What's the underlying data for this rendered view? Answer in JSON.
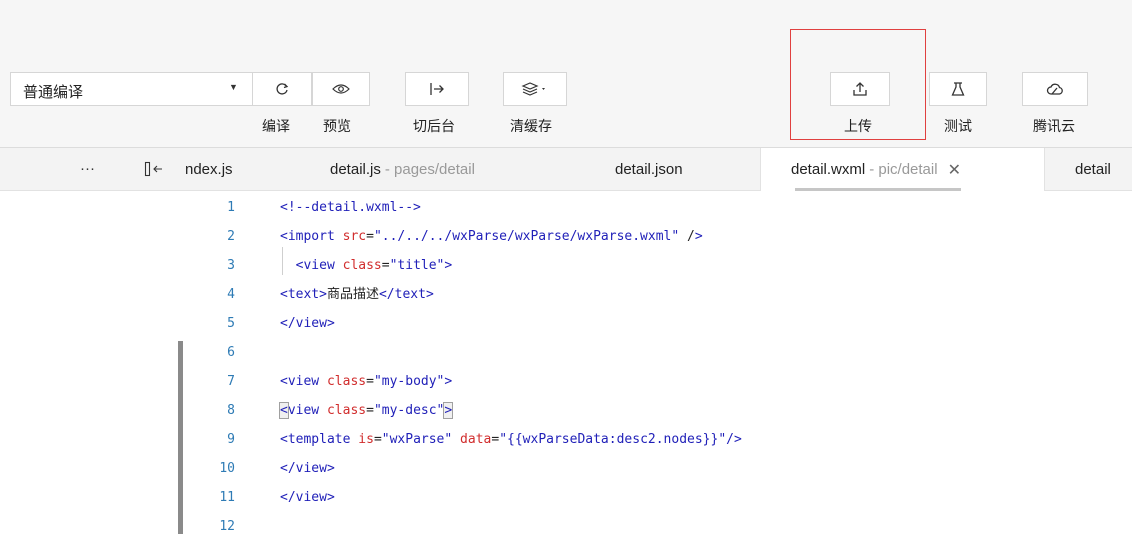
{
  "toolbar": {
    "compile_mode": "普通编译",
    "buttons": {
      "compile": "编译",
      "preview": "预览",
      "backend": "切后台",
      "clear_cache": "清缓存",
      "upload": "上传",
      "test": "测试",
      "tencent_cloud": "腾讯云"
    }
  },
  "tabs": {
    "more": "···",
    "items": [
      {
        "name": "ndex.js",
        "path": ""
      },
      {
        "name": "detail.js",
        "path": "- pages/detail"
      },
      {
        "name": "detail.json",
        "path": ""
      },
      {
        "name": "detail.wxml",
        "path": "- pic/detail"
      },
      {
        "name": "detail",
        "path": ""
      }
    ],
    "close_glyph": "✕"
  },
  "editor": {
    "line_numbers": [
      "1",
      "2",
      "3",
      "4",
      "5",
      "6",
      "7",
      "8",
      "9",
      "10",
      "11",
      "12"
    ],
    "lines": [
      "<!--detail.wxml-->",
      "<import src=\"../../../wxParse/wxParse/wxParse.wxml\" />",
      "  <view class=\"title\">",
      "<text>商品描述</text>",
      "</view>",
      "",
      "<view class=\"my-body\">",
      "<view class=\"my-desc\">",
      "<template is=\"wxParse\" data=\"{{wxParseData:desc2.nodes}}\"/>",
      "</view>",
      "</view>",
      ""
    ]
  },
  "icons": {
    "compile": "refresh-icon",
    "preview": "eye-icon",
    "backend": "switch-background-icon",
    "clear_cache": "layers-icon",
    "upload": "upload-icon",
    "test": "flask-icon",
    "tencent_cloud": "cloud-icon"
  },
  "colors": {
    "highlight_border": "#e0403f",
    "line_number": "#2e7bb5",
    "tag": "#1f1fb8",
    "attribute": "#d12d2d"
  }
}
